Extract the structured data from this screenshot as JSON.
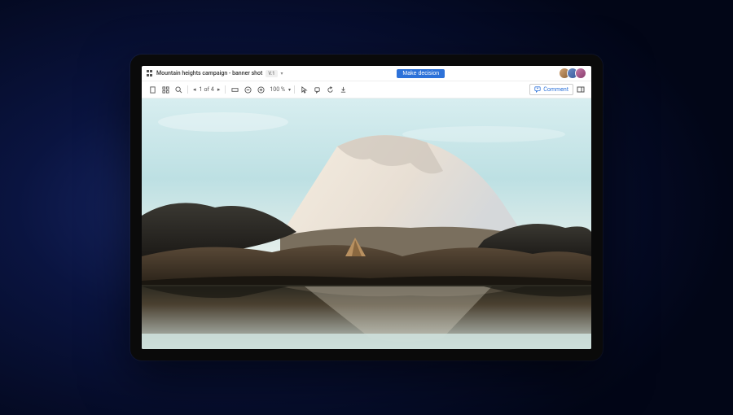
{
  "header": {
    "title": "Mountain heights campaign - banner shot",
    "version": "V.1",
    "primary_action": "Make decision"
  },
  "toolbar": {
    "pager": {
      "current": "1",
      "total": "4",
      "separator": "of"
    },
    "zoom": "100 %",
    "comment_label": "Comment"
  },
  "icons": {
    "apps": "apps-icon",
    "single_view": "single-page-icon",
    "grid_view": "grid-view-icon",
    "search": "search-icon",
    "fit": "fit-width-icon",
    "zoom_out": "zoom-out-icon",
    "zoom_in": "zoom-in-icon",
    "pointer": "pointer-icon",
    "annotate": "annotate-icon",
    "rotate": "rotate-icon",
    "download": "download-icon",
    "comment": "comment-icon",
    "panel": "panel-icon"
  },
  "avatars": [
    {
      "name": "user-1"
    },
    {
      "name": "user-2"
    },
    {
      "name": "user-3"
    }
  ]
}
